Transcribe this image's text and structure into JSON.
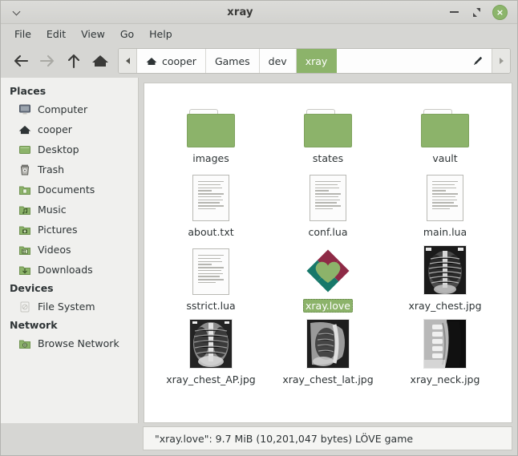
{
  "window": {
    "title": "xray",
    "menu_icon": "chevron-down-icon",
    "controls": {
      "minimize": "minimize-icon",
      "maximize": "restore-icon",
      "close": "×"
    }
  },
  "menubar": {
    "items": [
      {
        "label": "File"
      },
      {
        "label": "Edit"
      },
      {
        "label": "View"
      },
      {
        "label": "Go"
      },
      {
        "label": "Help"
      }
    ]
  },
  "toolbar": {
    "back": "back-arrow-icon",
    "forward": "forward-arrow-icon",
    "up": "up-arrow-icon",
    "home": "home-icon",
    "edit_path": "pencil-icon",
    "scroll_left": "scroll-left-icon",
    "scroll_right": "scroll-right-icon",
    "breadcrumbs": [
      {
        "label": "cooper",
        "icon": "home-icon",
        "active": false
      },
      {
        "label": "Games",
        "icon": "",
        "active": false
      },
      {
        "label": "dev",
        "icon": "",
        "active": false
      },
      {
        "label": "xray",
        "icon": "",
        "active": true
      }
    ]
  },
  "sidebar": {
    "sections": [
      {
        "title": "Places",
        "items": [
          {
            "label": "Computer",
            "icon": "computer-icon"
          },
          {
            "label": "cooper",
            "icon": "home-icon"
          },
          {
            "label": "Desktop",
            "icon": "desktop-icon"
          },
          {
            "label": "Trash",
            "icon": "trash-icon"
          },
          {
            "label": "Documents",
            "icon": "documents-folder-icon"
          },
          {
            "label": "Music",
            "icon": "music-folder-icon"
          },
          {
            "label": "Pictures",
            "icon": "pictures-folder-icon"
          },
          {
            "label": "Videos",
            "icon": "videos-folder-icon"
          },
          {
            "label": "Downloads",
            "icon": "downloads-folder-icon"
          }
        ]
      },
      {
        "title": "Devices",
        "items": [
          {
            "label": "File System",
            "icon": "drive-icon"
          }
        ]
      },
      {
        "title": "Network",
        "items": [
          {
            "label": "Browse Network",
            "icon": "network-folder-icon"
          }
        ]
      }
    ]
  },
  "files": [
    {
      "name": "images",
      "type": "folder",
      "selected": false
    },
    {
      "name": "states",
      "type": "folder",
      "selected": false
    },
    {
      "name": "vault",
      "type": "folder",
      "selected": false
    },
    {
      "name": "about.txt",
      "type": "document",
      "selected": false
    },
    {
      "name": "conf.lua",
      "type": "document",
      "selected": false
    },
    {
      "name": "main.lua",
      "type": "document",
      "selected": false
    },
    {
      "name": "sstrict.lua",
      "type": "document",
      "selected": false
    },
    {
      "name": "xray.love",
      "type": "love",
      "selected": true
    },
    {
      "name": "xray_chest.jpg",
      "type": "xray-chest-pa",
      "selected": false
    },
    {
      "name": "xray_chest_AP.jpg",
      "type": "xray-chest-ap",
      "selected": false
    },
    {
      "name": "xray_chest_lat.jpg",
      "type": "xray-chest-lat",
      "selected": false
    },
    {
      "name": "xray_neck.jpg",
      "type": "xray-neck",
      "selected": false
    }
  ],
  "statusbar": {
    "text": "\"xray.love\": 9.7 MiB (10,201,047 bytes) LÖVE game"
  },
  "colors": {
    "accent_green": "#8cb36a",
    "chrome": "#d6d6d3",
    "sidebar_bg": "#f0f0ee",
    "pane_bg": "#ffffff",
    "love_red": "#8e2a46",
    "love_teal": "#17786a",
    "love_heart": "#8cb36a"
  }
}
